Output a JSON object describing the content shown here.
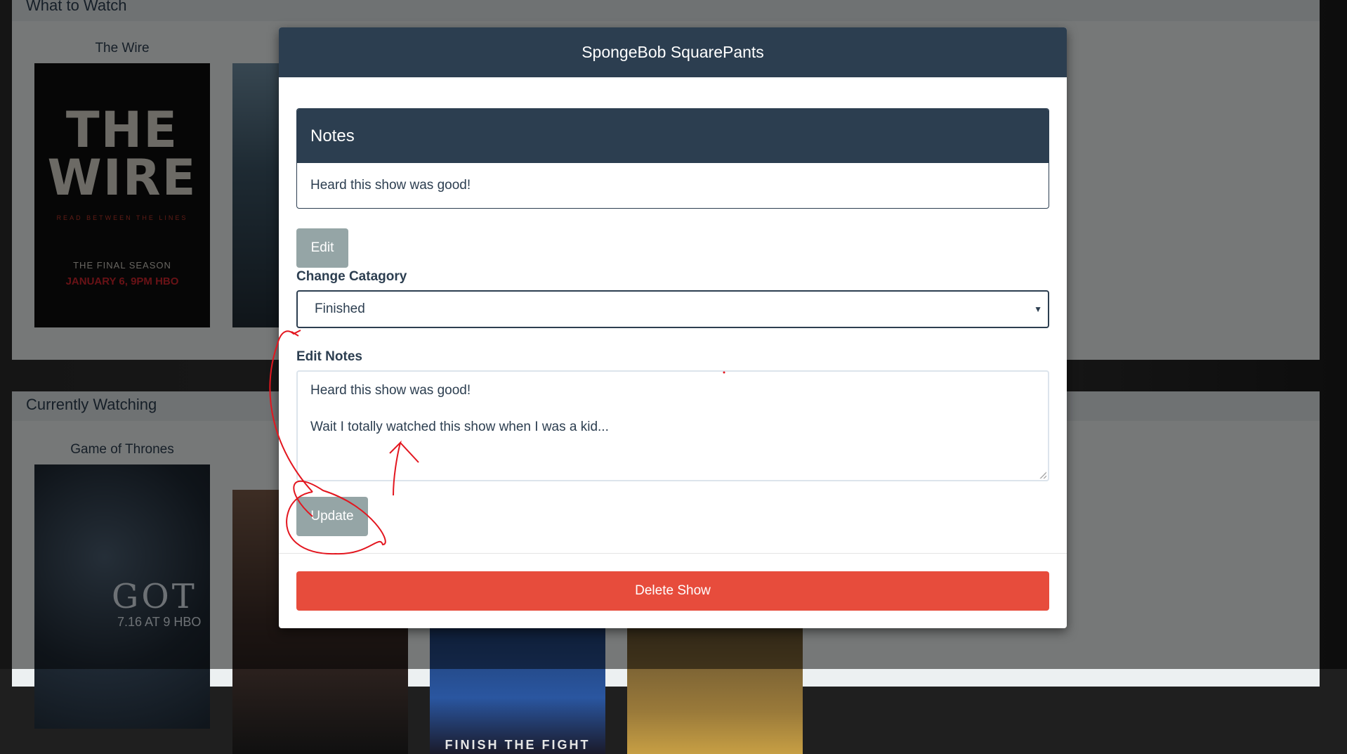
{
  "background": {
    "section_what_to_watch": "What to Watch",
    "section_currently_watching": "Currently Watching",
    "show_the_wire": "The Wire",
    "show_game_of_thrones": "Game of Thrones",
    "poster_wire_line1": "THE",
    "poster_wire_line2": "WIRE",
    "poster_wire_tagline": "READ BETWEEN THE LINES",
    "poster_wire_final": "THE FINAL SEASON",
    "poster_wire_date": "JANUARY 6, 9PM HBO",
    "poster_got_logo": "GOT",
    "poster_got_date": "7.16 AT 9 HBO",
    "poster_finish": "FINISH THE FIGHT"
  },
  "modal": {
    "title": "SpongeBob SquarePants",
    "notes_heading": "Notes",
    "notes_text": "Heard this show was good!",
    "edit_label": "Edit",
    "category_label": "Change Catagory",
    "category_selected": "Finished",
    "edit_notes_label": "Edit Notes",
    "edit_notes_line1": "Heard this show was good!",
    "edit_notes_line2": "Wait I totally watched this show when I was a kid...",
    "update_label": "Update",
    "delete_label": "Delete Show"
  },
  "colors": {
    "primary": "#2c3e50",
    "button_grey": "#95a5a6",
    "danger": "#e74c3c",
    "annotation": "#e3161f"
  },
  "icons": {
    "select_caret": "caret-down-icon"
  }
}
